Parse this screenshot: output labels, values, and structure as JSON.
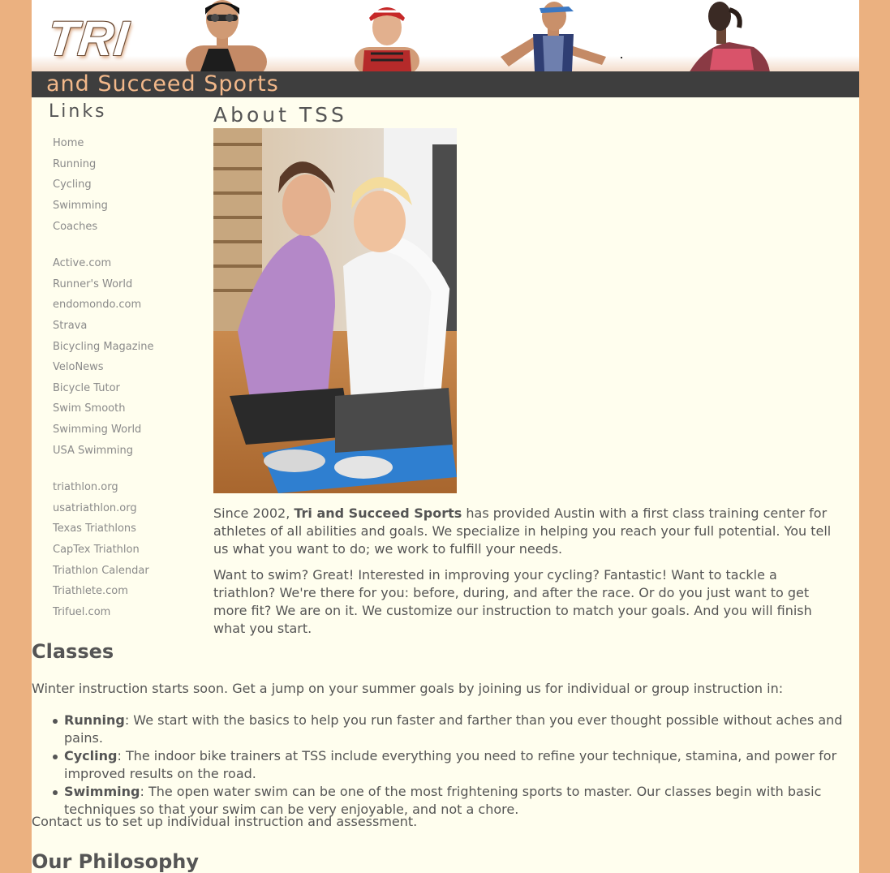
{
  "header": {
    "logo_text": "TRI",
    "tagline": "and Succeed Sports"
  },
  "sidebar": {
    "heading": "Links",
    "groups": [
      [
        "Home",
        "Running",
        "Cycling",
        "Swimming",
        "Coaches"
      ],
      [
        "Active.com",
        "Runner's World",
        "endomondo.com",
        "Strava",
        "Bicycling Magazine",
        "VeloNews",
        "Bicycle Tutor",
        "Swim Smooth",
        "Swimming World",
        "USA Swimming"
      ],
      [
        "triathlon.org",
        "usatriathlon.org",
        "Texas Triathlons",
        "CapTex Triathlon",
        "Triathlon Calendar",
        "Triathlete.com",
        "Trifuel.com"
      ]
    ]
  },
  "about": {
    "title": "About TSS",
    "p1_before": "Since 2002, ",
    "p1_bold": "Tri and Succeed Sports",
    "p1_after": " has provided Austin with a first class training center for athletes of all abilities and goals. We specialize in helping you reach your full potential. You tell us what you want to do; we work to fulfill your needs.",
    "p2": "Want to swim? Great! Interested in improving your cycling? Fantastic! Want to tackle a triathlon? We're there for you: before, during, and after the race. Or do you just want to get more fit? We are on it. We customize our instruction to match your goals. And you will finish what you start."
  },
  "classes": {
    "title": "Classes",
    "intro": "Winter instruction starts soon. Get a jump on your summer goals by joining us for individual or group instruction in:",
    "items": [
      {
        "name": "Running",
        "text": ": We start with the basics to help you run faster and farther than you ever thought possible without aches and pains."
      },
      {
        "name": "Cycling",
        "text": ": The indoor bike trainers at TSS include everything you need to refine your technique, stamina, and power for improved results on the road."
      },
      {
        "name": "Swimming",
        "text": ": The open water swim can be one of the most frightening sports to master. Our classes begin with basic techniques so that your swim can be very enjoyable, and not a chore."
      }
    ],
    "contact": "Contact us to set up individual instruction and assessment."
  },
  "philosophy": {
    "title": "Our Philosophy"
  },
  "colors": {
    "page_bg": "#ebb180",
    "content_bg": "#fffeee",
    "tagline_bar": "#3e3e3e",
    "tagline_text": "#f2b88a",
    "link": "#8a8a8a",
    "text": "#555555"
  }
}
